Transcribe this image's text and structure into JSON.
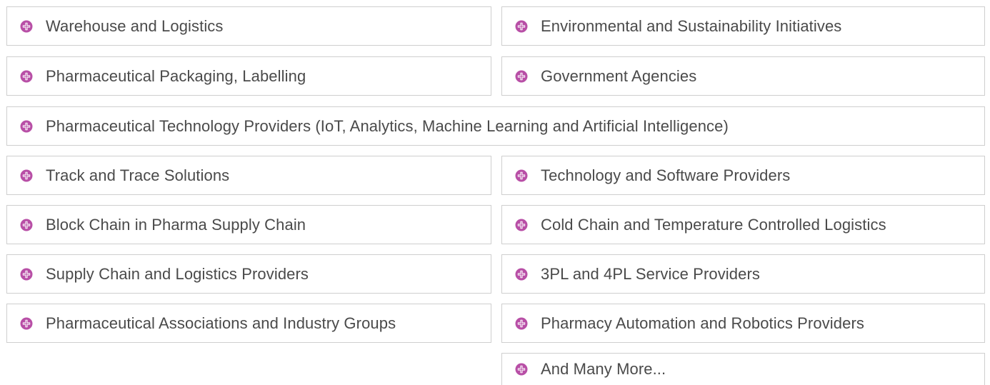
{
  "colors": {
    "icon_fill": "#b84fa6",
    "icon_cross": "#ffffff",
    "border": "#cfcfcf",
    "text": "#4a4a4a"
  },
  "icon_name": "plus-circle-icon",
  "items": [
    "Warehouse and Logistics",
    "Environmental and Sustainability Initiatives",
    "Pharmaceutical Packaging, Labelling",
    "Government Agencies",
    "Pharmaceutical Technology Providers (IoT, Analytics, Machine Learning and Artificial Intelligence)",
    "Track and Trace Solutions",
    "Technology and Software Providers",
    "Block Chain in Pharma Supply Chain",
    "Cold Chain and Temperature Controlled Logistics",
    "Supply Chain and Logistics Providers",
    "3PL and 4PL Service Providers",
    "Pharmaceutical Associations and Industry Groups",
    "Pharmacy Automation and Robotics Providers",
    "And Many More..."
  ]
}
